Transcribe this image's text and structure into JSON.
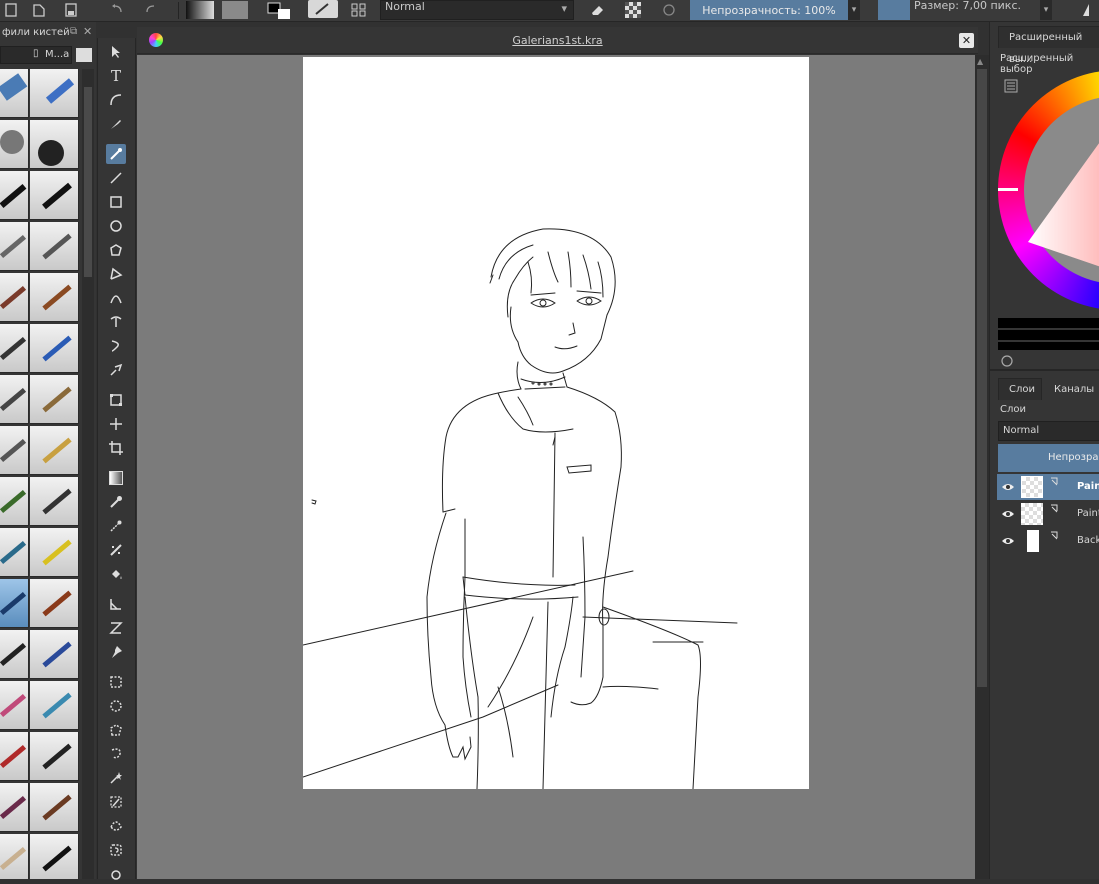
{
  "toolbar": {
    "blend_mode": "Normal",
    "opacity_label": "Непрозрачность: 100%",
    "size_label": "Размер: 7,00 пикс."
  },
  "brush_docker": {
    "title": "фили кистей",
    "filter_label": "М...а"
  },
  "document": {
    "title": "Galerians1st.kra"
  },
  "color_panel": {
    "tab_label": "Расширенный вы...",
    "subtitle": "Расширенный выбор"
  },
  "layers_panel": {
    "tabs": [
      {
        "label": "Слои"
      },
      {
        "label": "Каналы"
      }
    ],
    "title": "Слои",
    "blend_mode": "Normal",
    "opacity_label": "Непрозрач",
    "layers": [
      {
        "name": "Pain",
        "selected": true
      },
      {
        "name": "Paint",
        "selected": false
      },
      {
        "name": "Back",
        "selected": false
      }
    ]
  },
  "colors": {
    "accent": "#587c9f",
    "panel": "#353535",
    "canvas_bg": "#7b7b7b"
  }
}
